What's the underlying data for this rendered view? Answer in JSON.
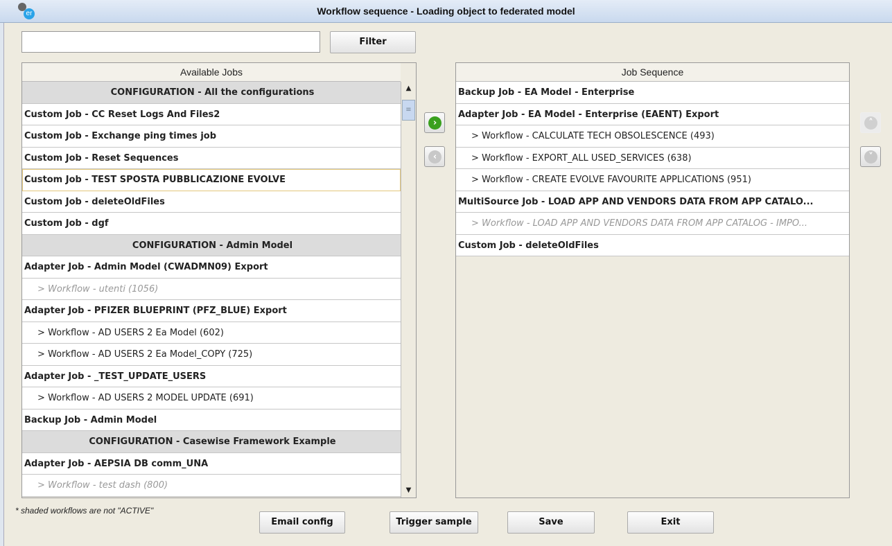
{
  "window": {
    "title": "Workflow sequence - Loading object to federated model",
    "icon_text": "er"
  },
  "filter": {
    "value": "",
    "button": "Filter"
  },
  "available": {
    "header": "Available Jobs",
    "rows": [
      {
        "t": "CONFIGURATION - All the configurations",
        "k": "cfg"
      },
      {
        "t": "Custom Job - CC Reset Logs And Files2",
        "k": "job"
      },
      {
        "t": "Custom Job - Exchange ping times job",
        "k": "job"
      },
      {
        "t": "Custom Job - Reset Sequences",
        "k": "job"
      },
      {
        "t": "Custom Job - TEST SPOSTA PUBBLICAZIONE EVOLVE",
        "k": "job",
        "selected": true
      },
      {
        "t": "Custom Job - deleteOldFiles",
        "k": "job"
      },
      {
        "t": "Custom Job - dgf",
        "k": "job"
      },
      {
        "t": "CONFIGURATION - Admin Model",
        "k": "cfg"
      },
      {
        "t": "Adapter Job - Admin Model (CWADMN09) Export",
        "k": "job"
      },
      {
        "t": "> Workflow - utenti (1056)",
        "k": "wf",
        "inactive": true
      },
      {
        "t": "Adapter Job - PFIZER BLUEPRINT (PFZ_BLUE) Export",
        "k": "job"
      },
      {
        "t": "> Workflow - AD USERS 2 Ea Model (602)",
        "k": "wf"
      },
      {
        "t": "> Workflow - AD USERS 2 Ea Model_COPY (725)",
        "k": "wf"
      },
      {
        "t": "Adapter Job - _TEST_UPDATE_USERS",
        "k": "job"
      },
      {
        "t": "> Workflow - AD USERS 2 MODEL UPDATE (691)",
        "k": "wf"
      },
      {
        "t": "Backup Job - Admin Model",
        "k": "job"
      },
      {
        "t": "CONFIGURATION - Casewise Framework Example",
        "k": "cfg"
      },
      {
        "t": "Adapter Job - AEPSIA DB comm_UNA",
        "k": "job"
      },
      {
        "t": "> Workflow - test dash (800)",
        "k": "wf",
        "inactive": true
      }
    ]
  },
  "sequence": {
    "header": "Job Sequence",
    "rows": [
      {
        "t": "Backup Job - EA Model - Enterprise",
        "k": "job"
      },
      {
        "t": "Adapter Job - EA Model - Enterprise (EAENT) Export",
        "k": "job"
      },
      {
        "t": "> Workflow - CALCULATE TECH OBSOLESCENCE (493)",
        "k": "wf"
      },
      {
        "t": "> Workflow - EXPORT_ALL USED_SERVICES (638)",
        "k": "wf"
      },
      {
        "t": "> Workflow - CREATE EVOLVE FAVOURITE APPLICATIONS (951)",
        "k": "wf"
      },
      {
        "t": "MultiSource Job - LOAD APP AND VENDORS DATA FROM APP CATALO...",
        "k": "job"
      },
      {
        "t": "> Workflow - LOAD APP AND VENDORS DATA FROM APP CATALOG - IMPO...",
        "k": "wf",
        "inactive": true
      },
      {
        "t": "Custom Job - deleteOldFiles",
        "k": "job"
      }
    ]
  },
  "footnote": "* shaded workflows are not \"ACTIVE\"",
  "buttons": {
    "email": "Email config",
    "trigger": "Trigger sample",
    "save": "Save",
    "exit": "Exit"
  },
  "colors": {
    "add": "#3aa01e",
    "disabled": "#c8c8c8"
  }
}
